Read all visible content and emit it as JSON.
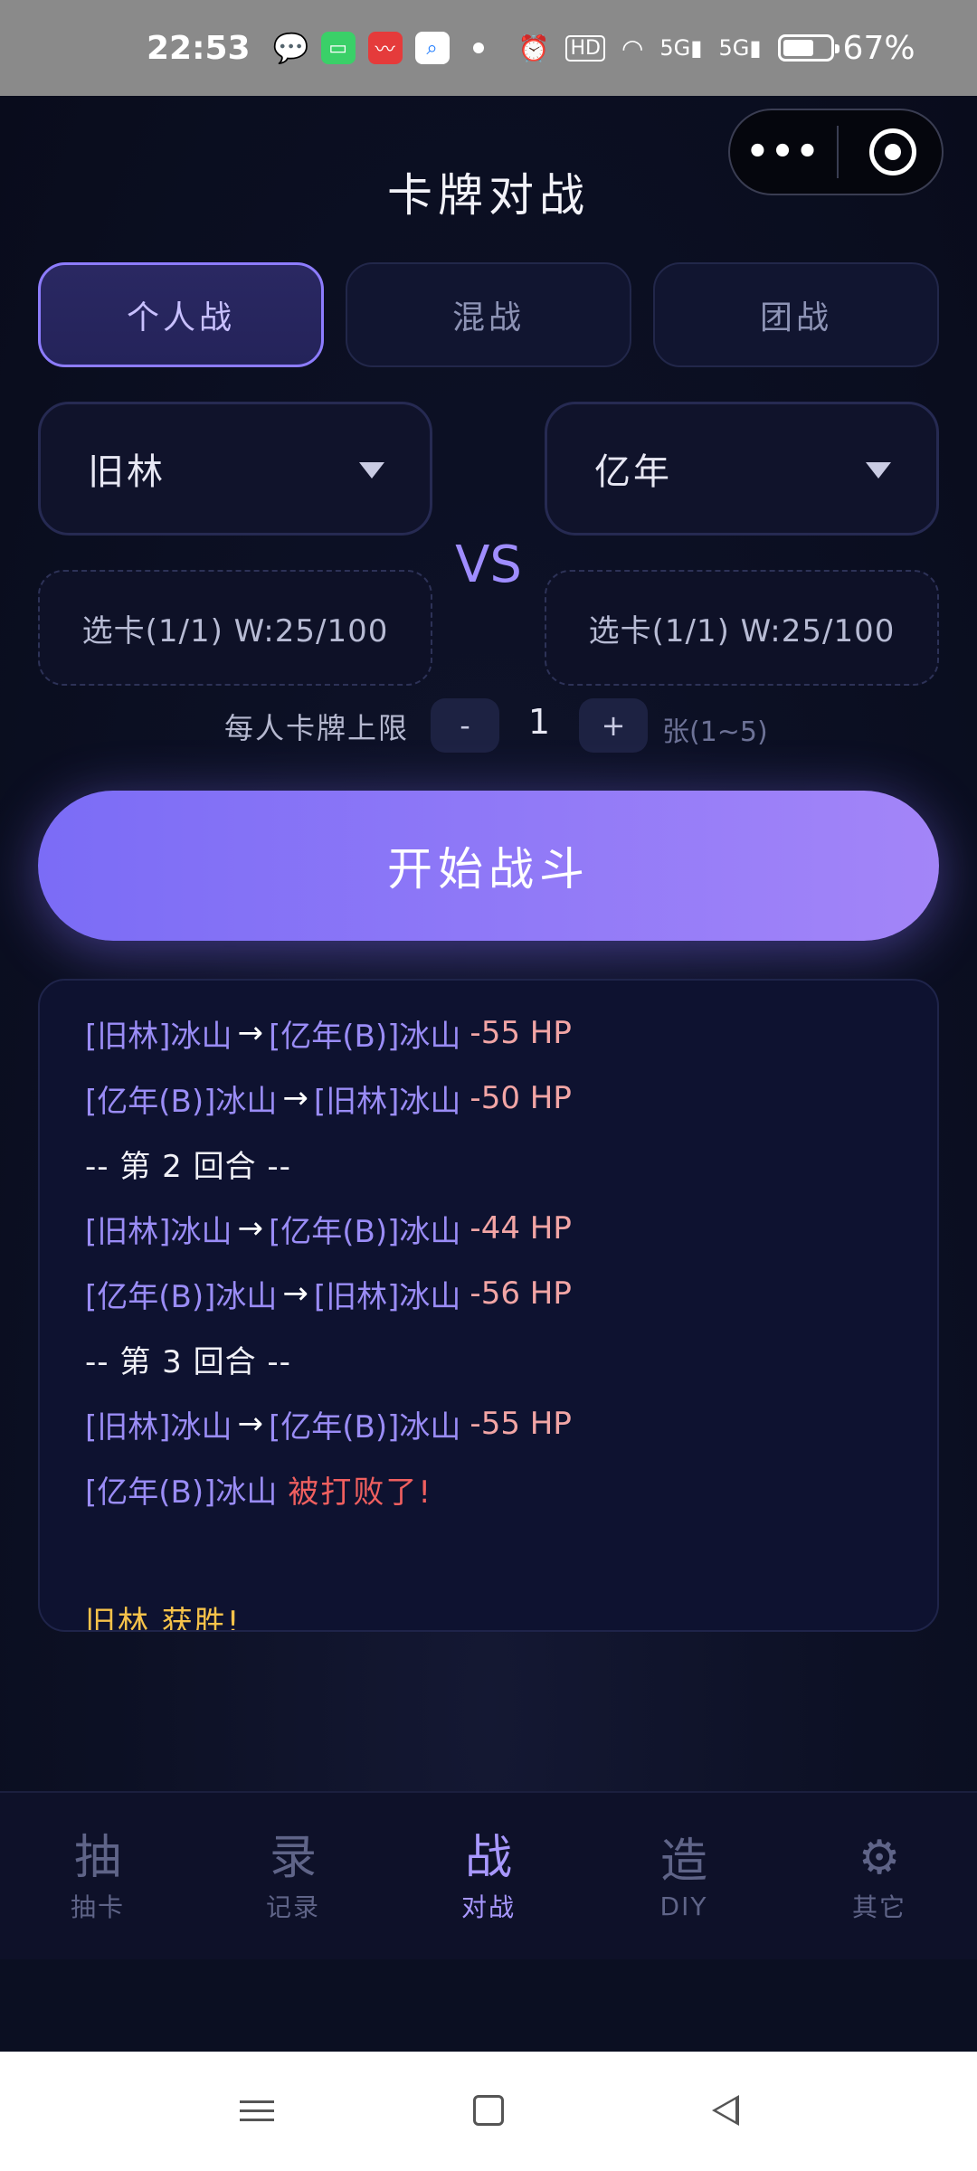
{
  "status_bar": {
    "time": "22:53",
    "battery_percent": "67%",
    "battery_level": 0.67,
    "icons": [
      "wechat-icon",
      "messages-icon",
      "stock-app-icon",
      "search-app-icon",
      "alarm-icon",
      "hd-icon",
      "wifi-icon",
      "signal-5g-icon",
      "signal-5g-icon",
      "battery-icon"
    ]
  },
  "header": {
    "title": "卡牌对战"
  },
  "modes": [
    {
      "label": "个人战",
      "active": true
    },
    {
      "label": "混战",
      "active": false
    },
    {
      "label": "团战",
      "active": false
    }
  ],
  "players": {
    "left": {
      "name": "旧林",
      "pick": "选卡(1/1) W:25/100"
    },
    "right": {
      "name": "亿年",
      "pick": "选卡(1/1) W:25/100"
    },
    "vs": "VS"
  },
  "limit": {
    "label": "每人卡牌上限",
    "minus": "-",
    "value": "1",
    "plus": "+",
    "unit": "张(1~5)"
  },
  "start_button": "开始战斗",
  "log": {
    "lines": [
      {
        "type": "attack",
        "attacker": "[旧林]冰山",
        "arrow": "→",
        "target": "[亿年(B)]冰山",
        "damage": "-55 HP"
      },
      {
        "type": "attack",
        "attacker": "[亿年(B)]冰山",
        "arrow": "→",
        "target": "[旧林]冰山",
        "damage": "-50 HP"
      },
      {
        "type": "round",
        "text": "-- 第 2 回合 --"
      },
      {
        "type": "attack",
        "attacker": "[旧林]冰山",
        "arrow": "→",
        "target": "[亿年(B)]冰山",
        "damage": "-44 HP"
      },
      {
        "type": "attack",
        "attacker": "[亿年(B)]冰山",
        "arrow": "→",
        "target": "[旧林]冰山",
        "damage": "-56 HP"
      },
      {
        "type": "round",
        "text": "-- 第 3 回合 --"
      },
      {
        "type": "attack",
        "attacker": "[旧林]冰山",
        "arrow": "→",
        "target": "[亿年(B)]冰山",
        "damage": "-55 HP"
      },
      {
        "type": "defeat",
        "unit": "[亿年(B)]冰山",
        "text": "被打败了!"
      },
      {
        "type": "blank"
      },
      {
        "type": "win",
        "text": "旧林 获胜!"
      }
    ]
  },
  "nav": [
    {
      "glyph": "抽",
      "label": "抽卡",
      "active": false
    },
    {
      "glyph": "录",
      "label": "记录",
      "active": false
    },
    {
      "glyph": "战",
      "label": "对战",
      "active": true
    },
    {
      "glyph": "造",
      "label": "DIY",
      "active": false
    },
    {
      "glyph": "⚙",
      "label": "其它",
      "active": false
    }
  ],
  "colors": {
    "accent": "#8d7cff",
    "background": "#0b0f22",
    "damage": "#f2a5a5",
    "defeat": "#ef5f5f",
    "win": "#f6c24a"
  }
}
